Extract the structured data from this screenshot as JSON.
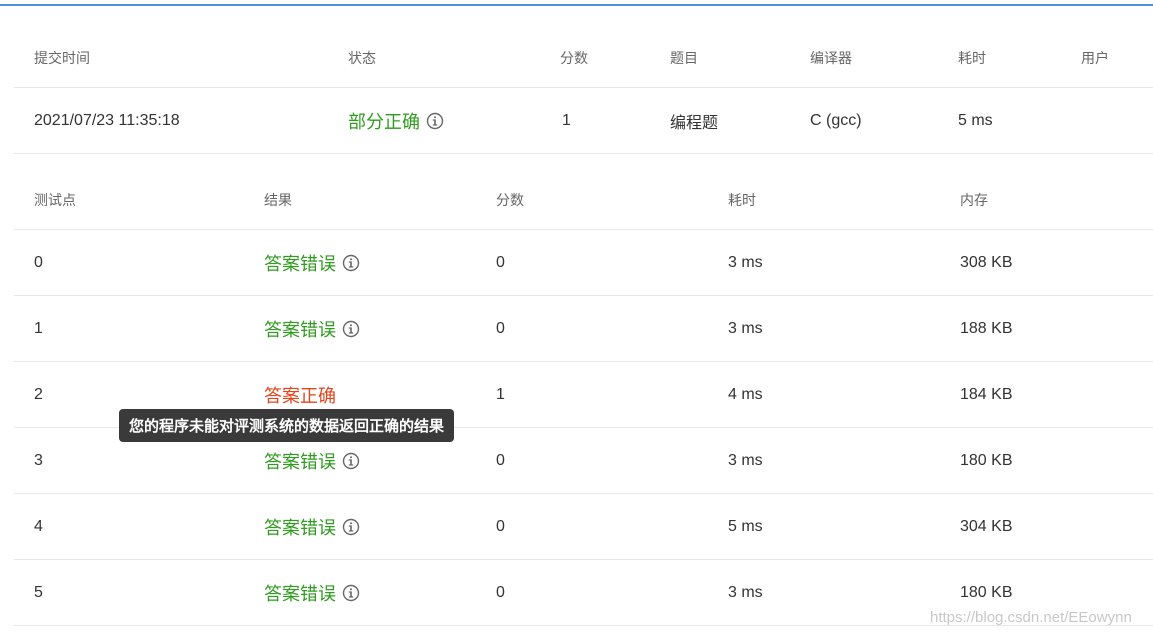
{
  "submission": {
    "headers": {
      "time": "提交时间",
      "status": "状态",
      "score": "分数",
      "problem": "题目",
      "compiler": "编译器",
      "duration": "耗时",
      "user": "用户"
    },
    "row": {
      "time": "2021/07/23 11:35:18",
      "status": "部分正确",
      "score": "1",
      "problem": "编程题",
      "compiler": "C (gcc)",
      "duration": "5 ms",
      "user": ""
    }
  },
  "testcases": {
    "headers": {
      "id": "测试点",
      "result": "结果",
      "score": "分数",
      "duration": "耗时",
      "memory": "内存"
    },
    "rows": [
      {
        "id": "0",
        "result": "答案错误",
        "result_type": "wrong",
        "score": "0",
        "duration": "3 ms",
        "memory": "308 KB"
      },
      {
        "id": "1",
        "result": "答案错误",
        "result_type": "wrong",
        "score": "0",
        "duration": "3 ms",
        "memory": "188 KB"
      },
      {
        "id": "2",
        "result": "答案正确",
        "result_type": "correct",
        "score": "1",
        "duration": "4 ms",
        "memory": "184 KB"
      },
      {
        "id": "3",
        "result": "答案错误",
        "result_type": "wrong",
        "score": "0",
        "duration": "3 ms",
        "memory": "180 KB"
      },
      {
        "id": "4",
        "result": "答案错误",
        "result_type": "wrong",
        "score": "0",
        "duration": "5 ms",
        "memory": "304 KB"
      },
      {
        "id": "5",
        "result": "答案错误",
        "result_type": "wrong",
        "score": "0",
        "duration": "3 ms",
        "memory": "180 KB"
      }
    ]
  },
  "tooltip": {
    "text": "您的程序未能对评测系统的数据返回正确的结果"
  },
  "watermark": "https://blog.csdn.net/EEowynn",
  "colors": {
    "accent_line": "#4a90d9",
    "wrong_green": "#2f9b1f",
    "correct_red": "#e0461c",
    "tooltip_bg": "#3a3a3a"
  },
  "icons": {
    "info": "info-circle-icon"
  }
}
